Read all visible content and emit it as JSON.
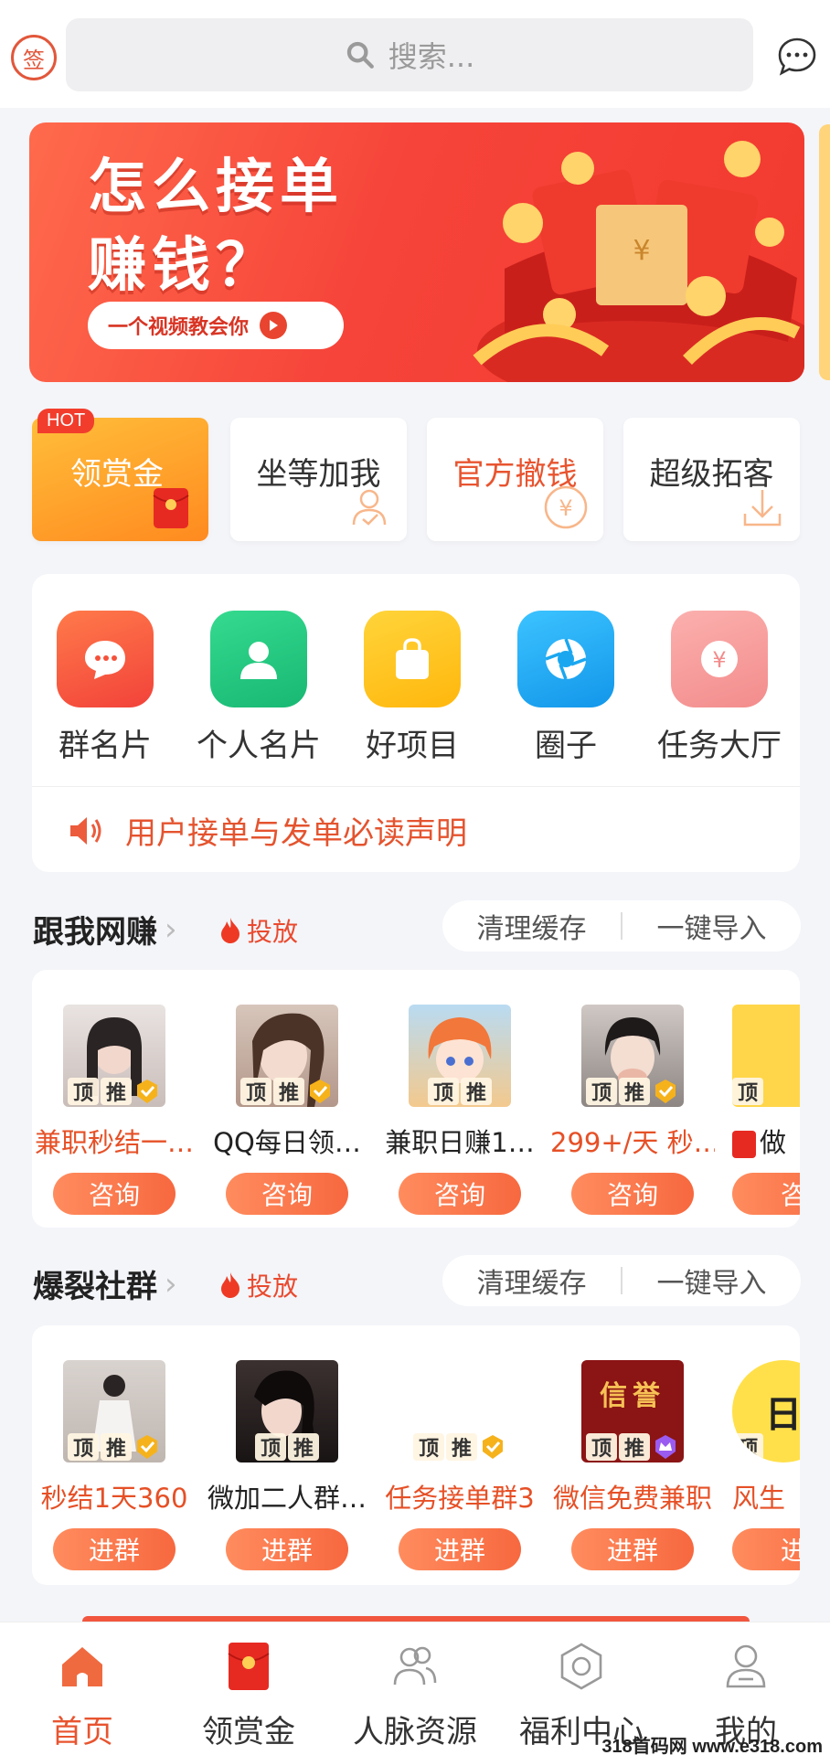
{
  "header": {
    "sign_label": "签",
    "search_placeholder": "搜索...",
    "message_icon": "chat-bubble-icon"
  },
  "banner": {
    "title_line1": "怎么接单",
    "title_line2": "赚钱？",
    "cta": "一个视频教会你"
  },
  "quick_tiles": [
    {
      "label": "领赏金",
      "badge": "HOT",
      "icon": "red-envelope-icon"
    },
    {
      "label": "坐等加我",
      "icon": "person-check-icon"
    },
    {
      "label": "官方撤钱",
      "icon": "yuan-coin-icon"
    },
    {
      "label": "超级拓客",
      "icon": "download-icon"
    }
  ],
  "categories": [
    {
      "label": "群名片",
      "icon": "chat-icon",
      "color": "#f5513a"
    },
    {
      "label": "个人名片",
      "icon": "person-icon",
      "color": "#22c77f"
    },
    {
      "label": "好项目",
      "icon": "bag-icon",
      "color": "#ffc21a"
    },
    {
      "label": "圈子",
      "icon": "aperture-icon",
      "color": "#1aa7f0"
    },
    {
      "label": "任务大厅",
      "icon": "yuan-icon",
      "color": "#f79a9a"
    }
  ],
  "notice": {
    "text": "用户接单与发单必读声明"
  },
  "section1": {
    "title": "跟我网赚",
    "fire_label": "投放",
    "clear_cache": "清理缓存",
    "import_all": "一键导入",
    "items": [
      {
        "name": "兼职秒结一…",
        "button": "咨询",
        "tag1": "顶",
        "tag2": "推"
      },
      {
        "name": "QQ每日领…",
        "button": "咨询",
        "tag1": "顶",
        "tag2": "推"
      },
      {
        "name": "兼职日赚1…",
        "button": "咨询",
        "tag1": "顶",
        "tag2": "推"
      },
      {
        "name": "299+/天 秒…",
        "button": "咨询",
        "tag1": "顶",
        "tag2": "推"
      },
      {
        "name": "做",
        "button": "咨",
        "tag1": "顶",
        "tag2": ""
      }
    ]
  },
  "section2": {
    "title": "爆裂社群",
    "fire_label": "投放",
    "clear_cache": "清理缓存",
    "import_all": "一键导入",
    "items": [
      {
        "name": "秒结1天360",
        "button": "进群",
        "tag1": "顶",
        "tag2": "推"
      },
      {
        "name": "微加二人群…",
        "button": "进群",
        "tag1": "顶",
        "tag2": "推"
      },
      {
        "name": "任务接单群3",
        "button": "进群",
        "tag1": "顶",
        "tag2": "推"
      },
      {
        "name": "微信免费兼职",
        "button": "进群",
        "tag1": "顶",
        "tag2": "推",
        "avatar_text": "信誉"
      },
      {
        "name": "风生",
        "button": "进",
        "tag1": "顶",
        "tag2": "",
        "avatar_text": "日"
      }
    ]
  },
  "tabbar": [
    {
      "label": "首页",
      "icon": "home-icon",
      "active": true
    },
    {
      "label": "领赏金",
      "icon": "red-envelope-icon",
      "active": false
    },
    {
      "label": "人脉资源",
      "icon": "people-icon",
      "active": false
    },
    {
      "label": "福利中心",
      "icon": "hexagon-icon",
      "active": false
    },
    {
      "label": "我的",
      "icon": "user-icon",
      "active": false
    }
  ],
  "watermark": "318首码网 www.e318.com",
  "colors": {
    "accent": "#e8542f",
    "brand_red": "#f23a2f"
  }
}
